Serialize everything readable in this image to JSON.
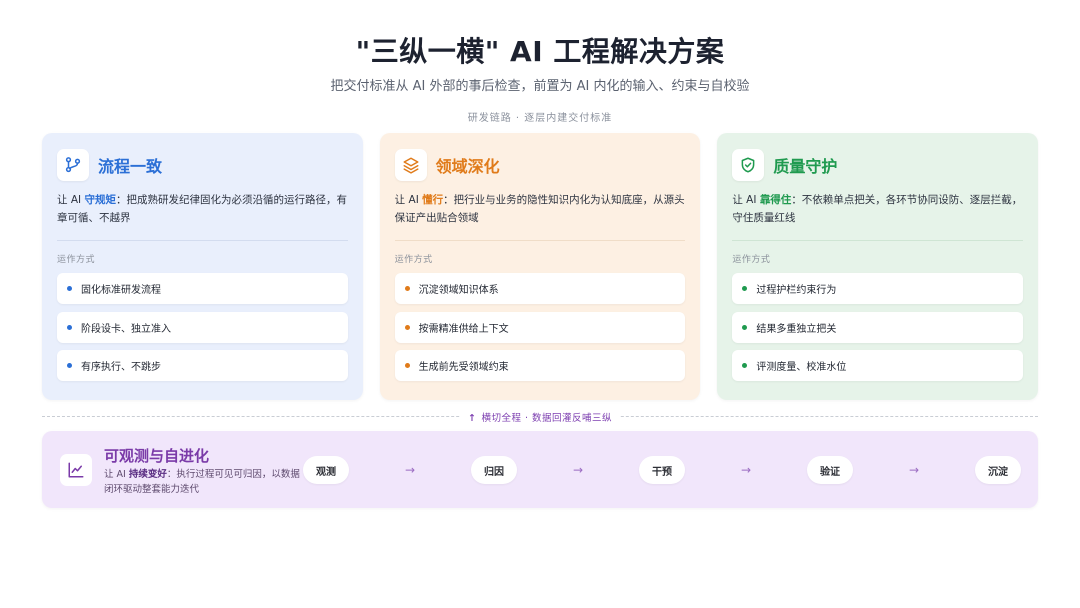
{
  "header": {
    "title": "\"三纵一横\" AI 工程解决方案",
    "subtitle": "把交付标准从 AI 外部的事后检查，前置为 AI 内化的输入、约束与自校验",
    "section_label": "研发链路 · 逐层内建交付标准"
  },
  "columns": [
    {
      "title": "流程一致",
      "icon": "git-branch-icon",
      "color": "#2b6fd6",
      "desc_prefix": "让 AI ",
      "desc_keyword": "守规矩",
      "desc_body": "：把成熟研发纪律固化为必须沿循的运行路径，有章可循、不越界",
      "mode_label": "运作方式",
      "items": [
        "固化标准研发流程",
        "阶段设卡、独立准入",
        "有序执行、不跳步"
      ]
    },
    {
      "title": "领域深化",
      "icon": "layers-icon",
      "color": "#e07b1a",
      "desc_prefix": "让 AI ",
      "desc_keyword": "懂行",
      "desc_body": "：把行业与业务的隐性知识内化为认知底座，从源头保证产出贴合领域",
      "mode_label": "运作方式",
      "items": [
        "沉淀领域知识体系",
        "按需精准供给上下文",
        "生成前先受领域约束"
      ]
    },
    {
      "title": "质量守护",
      "icon": "shield-check-icon",
      "color": "#1f9a4f",
      "desc_prefix": "让 AI ",
      "desc_keyword": "靠得住",
      "desc_body": "：不依赖单点把关，各环节协同设防、逐层拦截，守住质量红线",
      "mode_label": "运作方式",
      "items": [
        "过程护栏约束行为",
        "结果多重独立把关",
        "评测度量、校准水位"
      ]
    }
  ],
  "cross": {
    "label": "横切全程 · 数据回灌反哺三纵",
    "arrow_icon": "arrow-up-icon"
  },
  "bottom": {
    "title": "可观测与自进化",
    "icon": "line-chart-icon",
    "color": "#7a3aa8",
    "desc_prefix": "让 AI ",
    "desc_keyword": "持续变好",
    "desc_body": "：执行过程可见可归因，以数据闭环驱动整套能力迭代",
    "steps": [
      "观测",
      "归因",
      "干预",
      "验证",
      "沉淀"
    ],
    "step_arrow": "→"
  }
}
